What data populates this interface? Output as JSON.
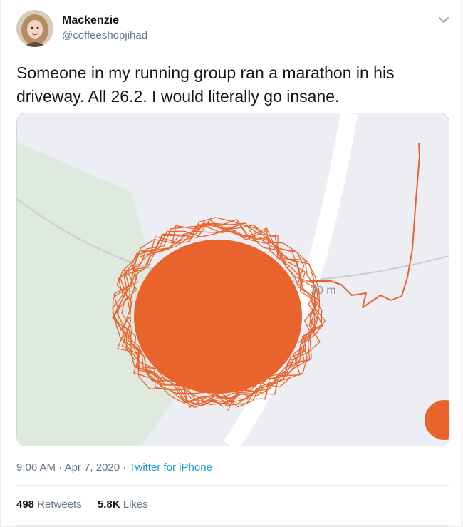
{
  "user": {
    "name": "Mackenzie",
    "handle": "@coffeeshopjihad"
  },
  "tweet": {
    "text": "Someone in my running group ran a marathon in his driveway. All 26.2. I would literally go insane."
  },
  "media": {
    "map_label": "30 m",
    "route_color": "#e8642c",
    "road_color": "#ffffff",
    "land_color": "#e9ebf2",
    "green_color": "#dfe9df"
  },
  "meta": {
    "time": "9:06 AM",
    "separator": "·",
    "date": "Apr 7, 2020",
    "source": "Twitter for iPhone"
  },
  "stats": {
    "retweets_count": "498",
    "retweets_label": "Retweets",
    "likes_count": "5.8K",
    "likes_label": "Likes"
  },
  "icons": {
    "chevron": "chevron-down-icon"
  }
}
